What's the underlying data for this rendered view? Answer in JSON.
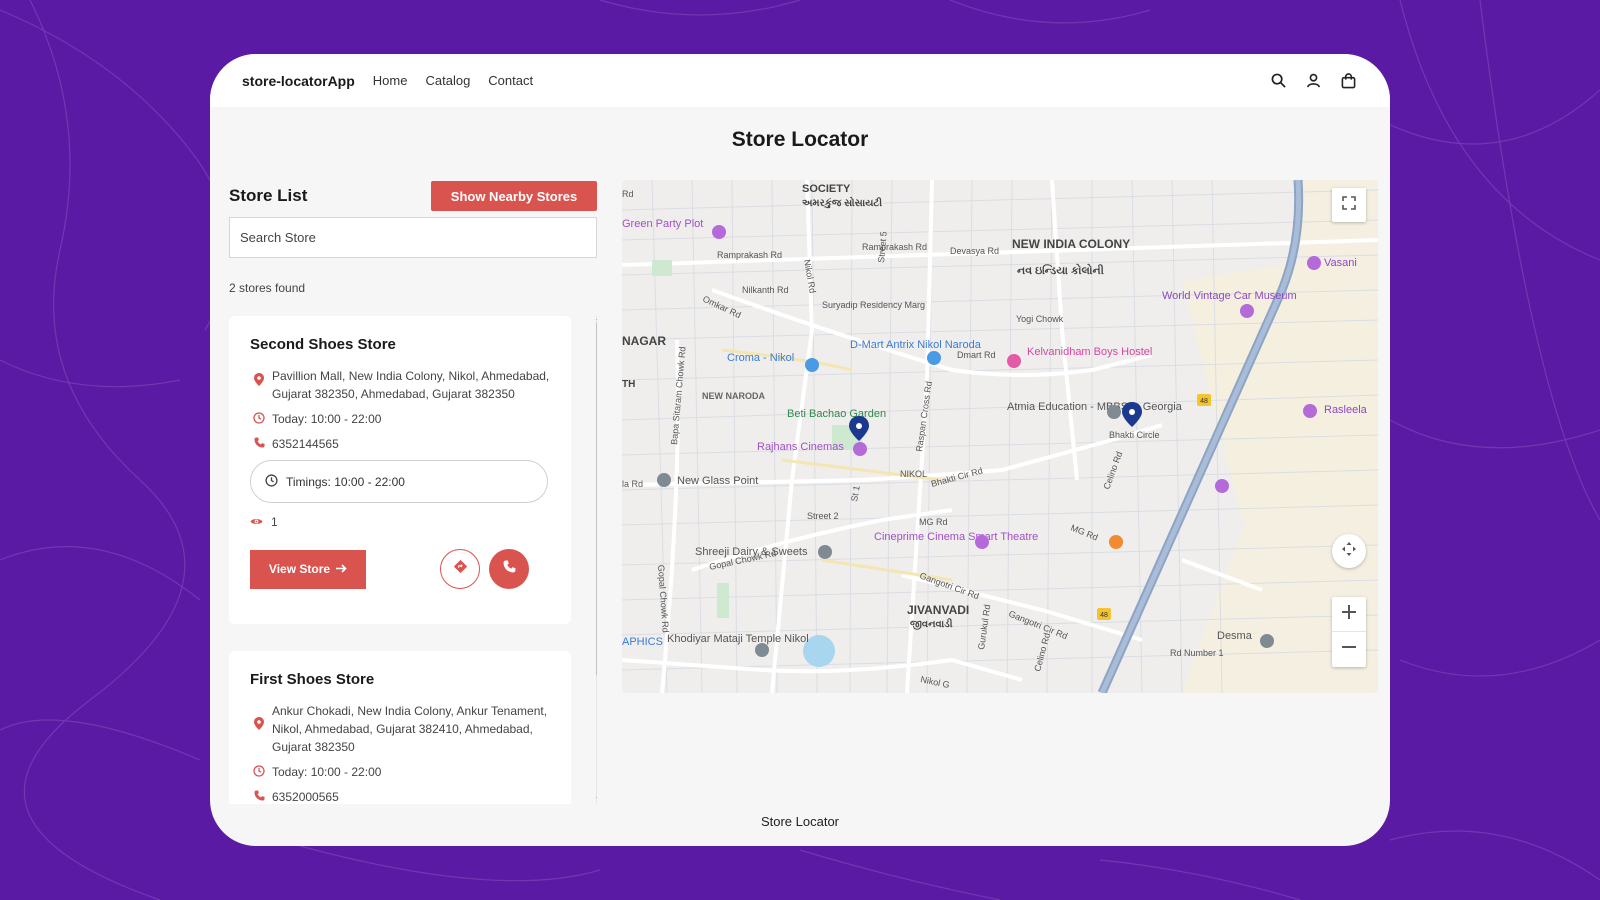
{
  "nav": {
    "brand": "store-locatorApp",
    "links": [
      "Home",
      "Catalog",
      "Contact"
    ],
    "icons": [
      "search-icon",
      "user-icon",
      "shopping-bag-icon"
    ]
  },
  "page": {
    "title": "Store Locator",
    "footer": "Store Locator"
  },
  "store_list": {
    "title": "Store List",
    "nearby_button": "Show Nearby Stores",
    "search_placeholder": "Search Store",
    "count_text": "2 stores found",
    "stores": [
      {
        "name": "Second Shoes Store",
        "address": "Pavillion Mall, New India Colony, Nikol, Ahmedabad, Gujarat 382350, Ahmedabad, Gujarat 382350",
        "today": "Today: 10:00 - 22:00",
        "phone": "6352144565",
        "timings": "Timings: 10:00 - 22:00",
        "views": "1",
        "view_button": "View Store"
      },
      {
        "name": "First Shoes Store",
        "address": "Ankur Chokadi, New India Colony, Ankur Tenament, Nikol, Ahmedabad, Gujarat 382410, Ahmedabad, Gujarat 382350",
        "today": "Today: 10:00 - 22:00",
        "phone": "6352000565"
      }
    ]
  },
  "map": {
    "labels": {
      "society": "SOCIETY",
      "society_gu": "અમરકુંજ સોસાયટી",
      "green_party_plot": "Green Party Plot",
      "ramprakash_rd": "Ramprakash Rd",
      "ramprakash_rd_2": "Ramprakash Rd",
      "devasya_rd": "Devasya Rd",
      "new_india_colony": "NEW INDIA COLONY",
      "new_india_colony_gu": "નવ ઇન્ડિયા કોલોની",
      "nilkanth_rd": "Nilkanth Rd",
      "suryadip": "Suryadip Residency Marg",
      "omkar_rd": "Omkar Rd",
      "nikol_rd": "Nikol Rd",
      "street_5": "Street 5",
      "yogi_chowk": "Yogi Chowk",
      "world_vintage": "World Vintage Car Museum",
      "vasani": "Vasani",
      "nagar": "NAGAR",
      "croma": "Croma - Nikol",
      "dmart": "D-Mart Antrix Nikol Naroda",
      "dmart_rd": "Dmart Rd",
      "kelvanidham": "Kelvanidham Boys Hostel",
      "new_naroda": "NEW NARODA",
      "beti_bachao": "Beti Bachao Garden",
      "atmia": "Atmia Education - MBBS in Georgia",
      "bhakti_circle": "Bhakti Circle",
      "rasleela": "Rasleela",
      "rajhans": "Rajhans Cinemas",
      "bapa_sitaram": "Bapa Sitaram Chowk Rd",
      "raspan_cross": "Raspan Cross Rd",
      "nikol": "NIKOL",
      "bhakti_cir_rd": "Bhakti Cir Rd",
      "new_glass_point": "New Glass Point",
      "celino_rd": "Celino Rd",
      "street_2": "Street 2",
      "gopal_chowk_rd": "Gopal Chowk Rd",
      "mg_rd": "MG Rd",
      "mg_rd_2": "MG Rd",
      "cineprime": "Cineprime Cinema Smart Theatre",
      "shreeji": "Shreeji Dairy & Sweets",
      "gangotri_cir_rd": "Gangotri Cir Rd",
      "gangotri_cir_rd_2": "Gangotri Cir Rd",
      "jivanvadi": "JIVANVADI",
      "jivanvadi_gu": "જીવનવાડી",
      "khodiyar": "Khodiyar Mataji Temple Nikol",
      "desma": "Desma",
      "rd_number_1": "Rd Number 1",
      "gurukul_rd": "Gurukul Rd",
      "celino_rd_2": "Celino Rd",
      "nikol_g": "Nikol G",
      "aphics": "APHICS",
      "la_rd": "la Rd",
      "th": "TH",
      "rd": "Rd",
      "route_48": "48",
      "route_48_2": "48",
      "st_1": "St 1",
      "gopal_chowk_rd_v": "Gopal Chowk Rd"
    }
  }
}
